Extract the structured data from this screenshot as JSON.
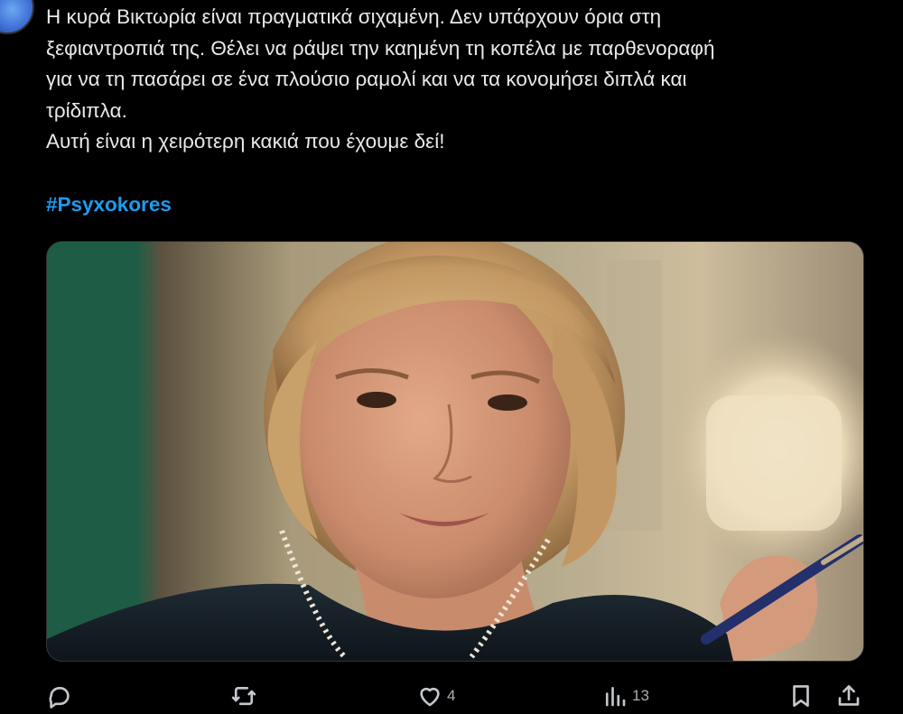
{
  "tweet": {
    "text_lines": [
      "Η κυρά Βικτωρία είναι πραγματικά σιχαμένη. Δεν υπάρχουν όρια στη",
      "ξεφιαντροπιά της. Θέλει να ράψει την καημένη τη κοπέλα με παρθενοραφή",
      "για να τη πασάρει σε ένα πλούσιο ραμολί και να τα κονομήσει διπλά και",
      "τρίδιπλα.",
      "Αυτή είναι η χειρότερη κακιά που έχουμε δεί!"
    ],
    "hashtag": "#Psyxokores"
  },
  "actions": {
    "reply_icon": "reply-icon",
    "retweet_icon": "retweet-icon",
    "like_icon": "heart-icon",
    "like_count": "4",
    "views_icon": "views-chart-icon",
    "views_count": "13",
    "bookmark_icon": "bookmark-icon",
    "share_icon": "share-icon"
  },
  "colors": {
    "background": "#000000",
    "text": "#e7e9ea",
    "hashtag": "#1d9bf0",
    "muted": "#71767b"
  }
}
